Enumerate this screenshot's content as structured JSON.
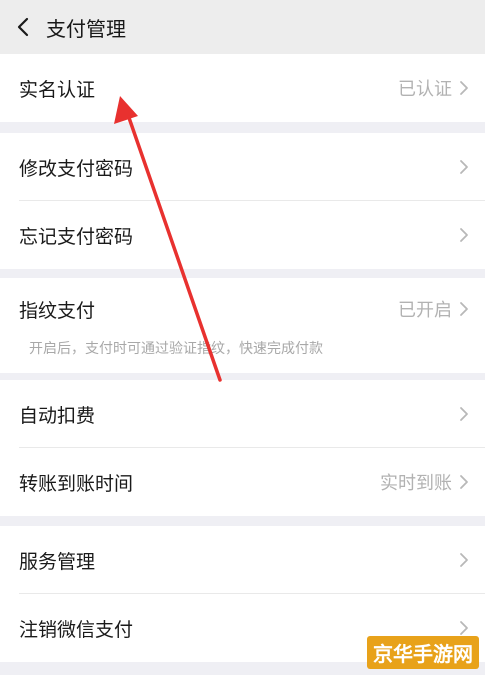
{
  "header": {
    "title": "支付管理",
    "back_icon": "chevron-left-icon"
  },
  "groups": [
    {
      "items": [
        {
          "label": "实名认证",
          "value": "已认证"
        }
      ]
    },
    {
      "items": [
        {
          "label": "修改支付密码",
          "value": ""
        },
        {
          "label": "忘记支付密码",
          "value": ""
        }
      ]
    },
    {
      "items": [
        {
          "label": "指纹支付",
          "value": "已开启"
        }
      ],
      "hint": "开启后，支付时可通过验证指纹，快速完成付款"
    },
    {
      "items": [
        {
          "label": "自动扣费",
          "value": ""
        },
        {
          "label": "转账到账时间",
          "value": "实时到账"
        }
      ]
    },
    {
      "items": [
        {
          "label": "服务管理",
          "value": ""
        },
        {
          "label": "注销微信支付",
          "value": ""
        }
      ]
    }
  ],
  "annotation": {
    "arrow_color": "#e8312f"
  },
  "watermark": {
    "text": "京华手游网"
  },
  "colors": {
    "background": "#efeff4",
    "card": "#ffffff",
    "value_text": "#b2b2b2",
    "chevron": "#b8b8b8"
  }
}
